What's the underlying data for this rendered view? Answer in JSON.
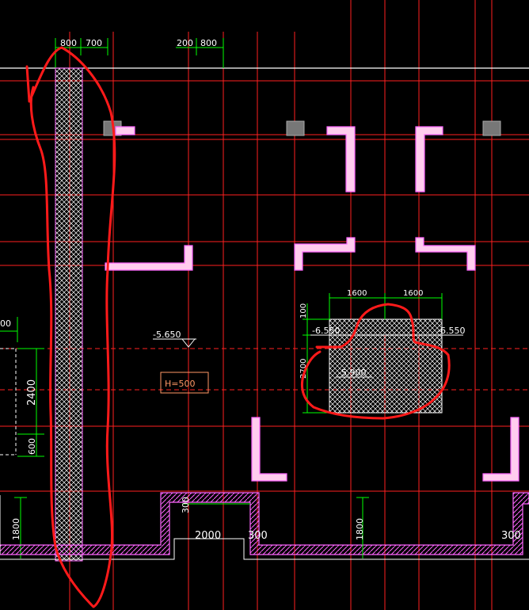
{
  "dimensions": {
    "top_800_a": "800",
    "top_700": "700",
    "top_200": "200",
    "top_800_b": "800",
    "left_00": "00",
    "left_2400": "2400",
    "left_600": "600",
    "left_1800": "1800",
    "pit_300": "300",
    "pit_2000": "2000",
    "pit_300_right": "300",
    "mid_1800": "1800",
    "right_300": "300",
    "found_1600_left": "1600",
    "found_1600_right": "1600",
    "found_100": "100",
    "found_2700": "2700"
  },
  "levels": {
    "floor": "-5.650",
    "found_top_left": "-6.550",
    "found_top_right": "-6.550",
    "found_bottom": "-5.900"
  },
  "labels": {
    "height_box": "H=500"
  },
  "colors": {
    "background": "#000000",
    "grid": "#ff2020",
    "dimension": "#00ff00",
    "wall": "#ff66ff",
    "markup": "#ff0000"
  }
}
